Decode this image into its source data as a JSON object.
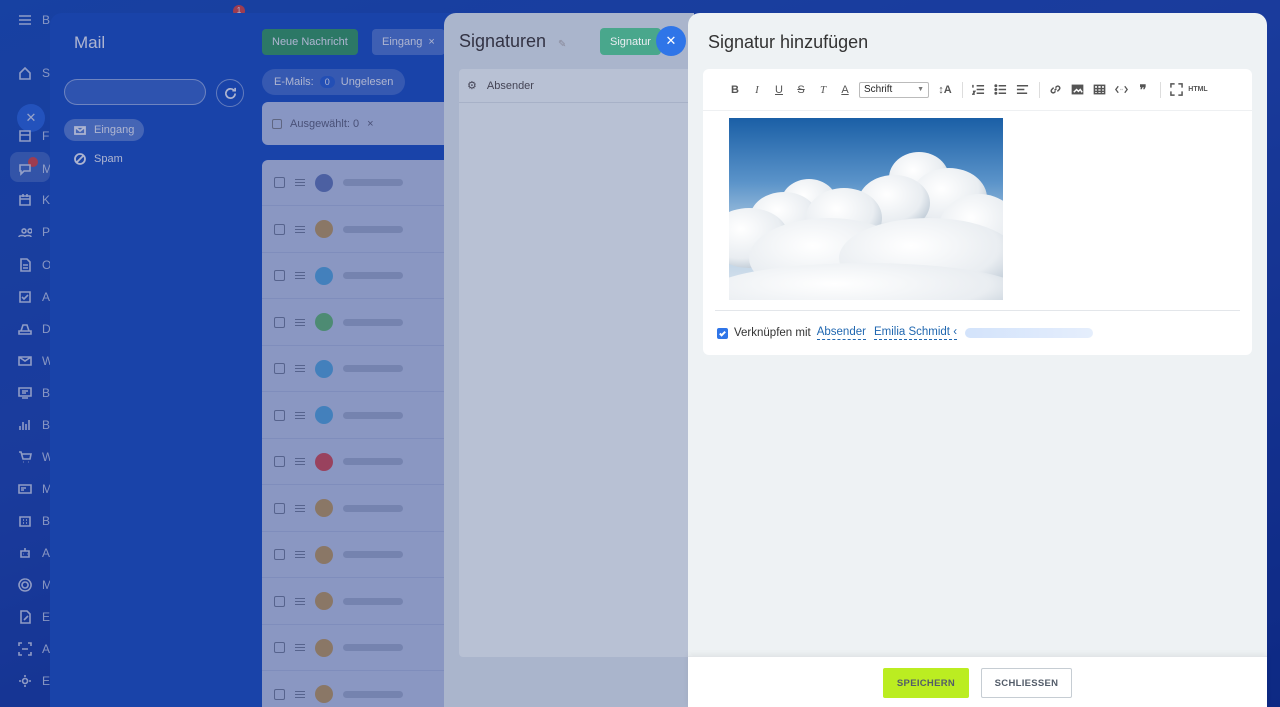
{
  "appbar": {
    "items": [
      {
        "letter": "S",
        "icon": "home-icon"
      },
      {
        "letter": "F",
        "icon": "feed-icon"
      },
      {
        "letter": "M",
        "icon": "chat-icon"
      },
      {
        "letter": "K",
        "icon": "calendar-icon"
      },
      {
        "letter": "P",
        "icon": "users-icon"
      },
      {
        "letter": "O",
        "icon": "document-icon"
      },
      {
        "letter": "A",
        "icon": "checkbox-icon"
      },
      {
        "letter": "D",
        "icon": "drive-icon"
      },
      {
        "letter": "W",
        "icon": "mail-icon"
      },
      {
        "letter": "B",
        "icon": "board-icon"
      },
      {
        "letter": "B",
        "icon": "chart-icon"
      },
      {
        "letter": "W",
        "icon": "cart-icon"
      },
      {
        "letter": "M",
        "icon": "card-icon"
      },
      {
        "letter": "B",
        "icon": "calendar-grid-icon"
      },
      {
        "letter": "A",
        "icon": "robot-icon"
      },
      {
        "letter": "M",
        "icon": "target-icon"
      },
      {
        "letter": "E",
        "icon": "edit-doc-icon"
      },
      {
        "letter": "A",
        "icon": "scan-icon"
      },
      {
        "letter": "E",
        "icon": "gear-icon"
      }
    ],
    "top_letter": "B",
    "badge": "1"
  },
  "mail": {
    "title": "Mail",
    "new_message": "Neue Nachricht",
    "inbox_filter": "Eingang",
    "emails_label": "E-Mails:",
    "unread_count": "0",
    "unread_label": "Ungelesen",
    "selected_label": "Ausgewählt: 0",
    "folders": [
      {
        "label": "Eingang",
        "active": true
      },
      {
        "label": "Spam",
        "active": false
      }
    ],
    "row_avatar_colors": [
      "#6b7fb8",
      "#c9a15c",
      "#5cb0e0",
      "#6cc070",
      "#5cb0e0",
      "#5cb0e0",
      "#e05050",
      "#c9a15c",
      "#c9a15c",
      "#c9a15c",
      "#c9a15c",
      "#c9a15c"
    ]
  },
  "signaturen": {
    "title": "Signaturen",
    "add_button": "Signatur",
    "column_header": "Absender"
  },
  "slider": {
    "title": "Signatur hinzufügen",
    "toolbar": {
      "bold": "B",
      "italic": "I",
      "underline": "U",
      "strike": "S",
      "clear": "T",
      "color": "A",
      "font_select": "Schrift",
      "size": "↕A",
      "html": "HTML"
    },
    "link_label": "Verknüpfen mit",
    "link_type": "Absender",
    "link_sender": "Emilia Schmidt ‹",
    "save": "SPEICHERN",
    "close": "SCHLIESSEN"
  }
}
